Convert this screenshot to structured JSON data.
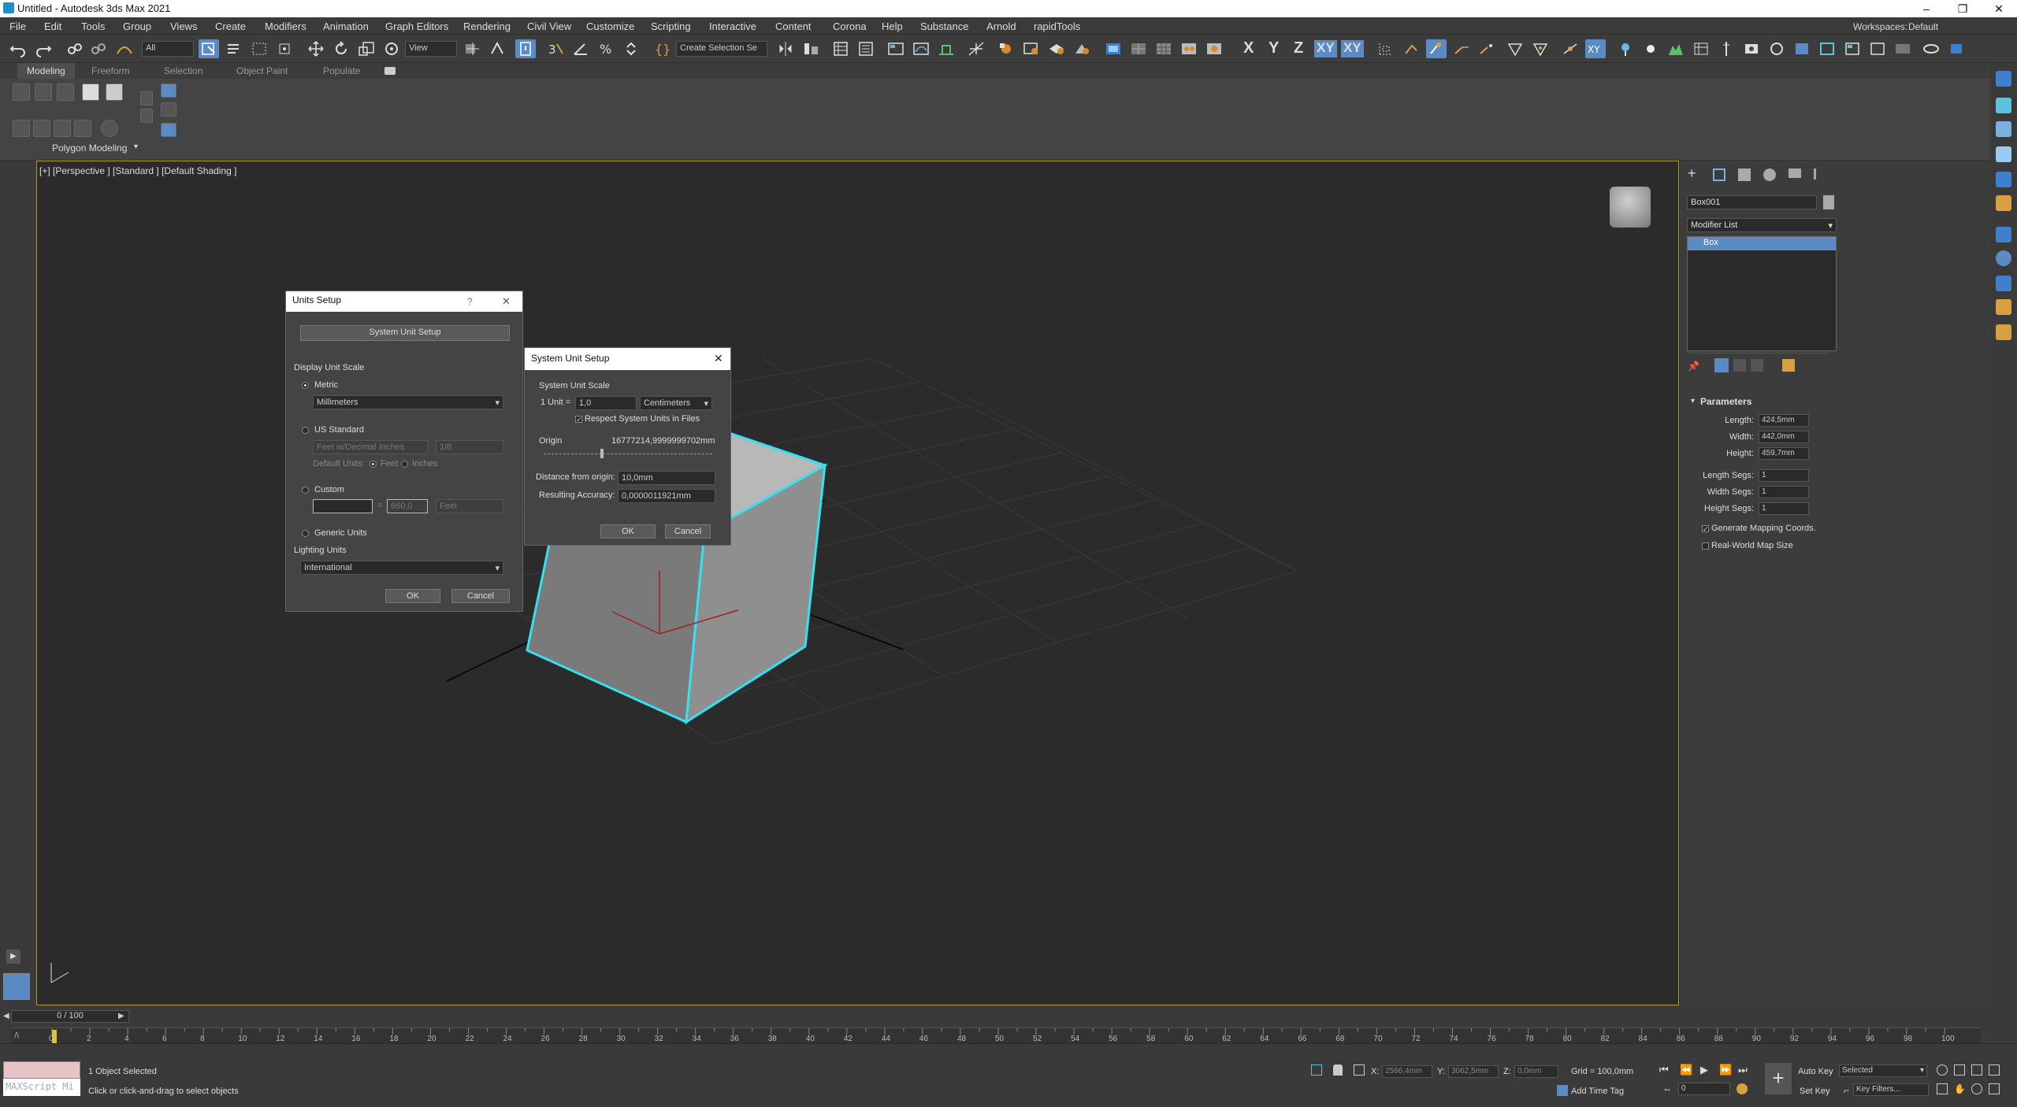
{
  "window": {
    "title": "Untitled - Autodesk 3ds Max 2021",
    "minimize": "–",
    "restore": "❐",
    "close": "✕"
  },
  "menubar": {
    "items": [
      "File",
      "Edit",
      "Tools",
      "Group",
      "Views",
      "Create",
      "Modifiers",
      "Animation",
      "Graph Editors",
      "Rendering",
      "Civil View",
      "Customize",
      "Scripting",
      "Interactive",
      "Content",
      "Corona",
      "Help",
      "Substance",
      "Arnold",
      "rapidTools"
    ],
    "workspaces_label": "Workspaces:",
    "workspaces_value": "Default"
  },
  "toolbar": {
    "selection_filter": "All",
    "ref_coord": "View",
    "selection_set": "Create Selection Se",
    "axis_x": "X",
    "axis_y": "Y",
    "axis_z": "Z",
    "axis_xy": "XY",
    "axis_xy2": "XY"
  },
  "ribbon": {
    "tabs": [
      "Modeling",
      "Freeform",
      "Selection",
      "Object Paint",
      "Populate"
    ],
    "panel_label": "Polygon Modeling"
  },
  "viewport": {
    "label": "[+] [Perspective ] [Standard ] [Default Shading ]",
    "selection_color": "#35e0f0"
  },
  "units_dialog": {
    "title": "Units Setup",
    "help": "?",
    "close": "✕",
    "system_unit_button": "System Unit Setup",
    "display_unit_scale": "Display Unit Scale",
    "metric_label": "Metric",
    "metric_value": "Millimeters",
    "us_standard_label": "US Standard",
    "us_value": "Feet w/Decimal Inches",
    "us_fraction": "1/8",
    "default_units_label": "Default Units:",
    "feet_label": "Feet",
    "inches_label": "Inches",
    "custom_label": "Custom",
    "custom_value": "",
    "custom_eq": "=",
    "custom_num": "660,0",
    "custom_unit": "Feet",
    "generic_label": "Generic Units",
    "lighting_units": "Lighting Units",
    "lighting_value": "International",
    "ok": "OK",
    "cancel": "Cancel"
  },
  "system_dialog": {
    "title": "System Unit Setup",
    "close": "✕",
    "scale_group": "System Unit Scale",
    "unit_prefix": "1 Unit =",
    "unit_value": "1,0",
    "unit_type": "Centimeters",
    "respect_label": "Respect System Units in Files",
    "origin_label": "Origin",
    "origin_value": "16777214,9999999702mm",
    "distance_label": "Distance from origin:",
    "distance_value": "10,0mm",
    "accuracy_label": "Resulting Accuracy:",
    "accuracy_value": "0,0000011921mm",
    "ok": "OK",
    "cancel": "Cancel"
  },
  "command_panel": {
    "object_name": "Box001",
    "modifier_list": "Modifier List",
    "stack_item": "Box",
    "params_title": "Parameters",
    "params": [
      {
        "label": "Length:",
        "value": "424,5mm"
      },
      {
        "label": "Width:",
        "value": "442,0mm"
      },
      {
        "label": "Height:",
        "value": "459,7mm"
      },
      {
        "label": "Length Segs:",
        "value": "1"
      },
      {
        "label": "Width Segs:",
        "value": "1"
      },
      {
        "label": "Height Segs:",
        "value": "1"
      }
    ],
    "gen_mapping": "Generate Mapping Coords.",
    "real_world": "Real-World Map Size"
  },
  "timeline": {
    "slider": "0 / 100",
    "ticks": [
      "0",
      "2",
      "4",
      "6",
      "8",
      "10",
      "12",
      "14",
      "16",
      "18",
      "20",
      "22",
      "24",
      "26",
      "28",
      "30",
      "32",
      "34",
      "36",
      "38",
      "40",
      "42",
      "44",
      "46",
      "48",
      "50",
      "52",
      "54",
      "56",
      "58",
      "60",
      "62",
      "64",
      "66",
      "68",
      "70",
      "72",
      "74",
      "76",
      "78",
      "80",
      "82",
      "84",
      "86",
      "88",
      "90",
      "92",
      "94",
      "96",
      "98",
      "100"
    ]
  },
  "status": {
    "maxscript": "MAXScript Mi",
    "selected": "1 Object Selected",
    "prompt": "Click or click-and-drag to select objects",
    "x_label": "X:",
    "x_value": "2566,4mm",
    "y_label": "Y:",
    "y_value": "3062,5mm",
    "z_label": "Z:",
    "z_value": "0,0mm",
    "grid": "Grid = 100,0mm",
    "add_time_tag": "Add Time Tag",
    "auto_key": "Auto Key",
    "set_key": "Set Key",
    "key_mode": "Selected",
    "key_filters": "Key Filters...",
    "frame": "0"
  }
}
